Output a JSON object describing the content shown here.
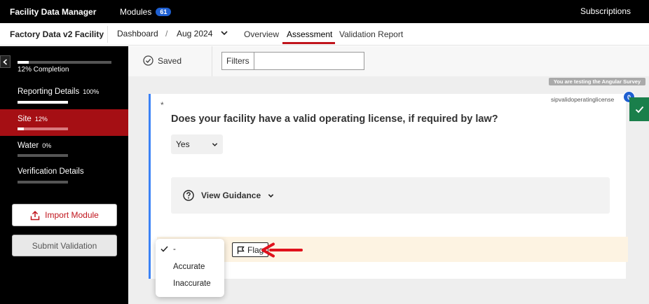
{
  "topbar": {
    "app_title": "Facility Data Manager",
    "modules_label": "Modules",
    "modules_count": "61",
    "subscriptions": "Subscriptions"
  },
  "navbar": {
    "facility": "Factory Data v2 Facility",
    "breadcrumb_dashboard": "Dashboard",
    "breadcrumb_sep": "/",
    "breadcrumb_period": "Aug 2024",
    "tabs": [
      {
        "label": "Overview",
        "active": false
      },
      {
        "label": "Assessment",
        "active": true
      },
      {
        "label": "Validation Report",
        "active": false
      }
    ]
  },
  "sidebar": {
    "completion_label": "12% Completion",
    "completion_value": 12,
    "items": [
      {
        "label": "Reporting Details",
        "pct": "100%",
        "progress": 100
      },
      {
        "label": "Site",
        "pct": "12%",
        "progress": 12,
        "active": true
      },
      {
        "label": "Water",
        "pct": "0%",
        "progress": 0
      },
      {
        "label": "Verification Details",
        "pct": "",
        "progress": 0
      }
    ],
    "import_label": "Import Module",
    "submit_label": "Submit Validation"
  },
  "toolbar": {
    "saved_label": "Saved",
    "filters_label": "Filters",
    "filters_value": ""
  },
  "banner": "You are testing the Angular Survey",
  "question": {
    "asterisk": "*",
    "id": "sipvalidoperatinglicense",
    "comment_count": "0",
    "text": "Does your facility have a valid operating license, if required by law?",
    "answer": "Yes",
    "guidance_label": "View Guidance"
  },
  "validation": {
    "flag_label": "Flag",
    "options": [
      "-",
      "Accurate",
      "Inaccurate"
    ],
    "selected": "-"
  },
  "colors": {
    "brand_red": "#c0141c",
    "sidebar_active": "#a50f14",
    "badge_blue": "#1e5fd1",
    "card_accent": "#3b82f6",
    "complete_green": "#1a7f4b"
  }
}
